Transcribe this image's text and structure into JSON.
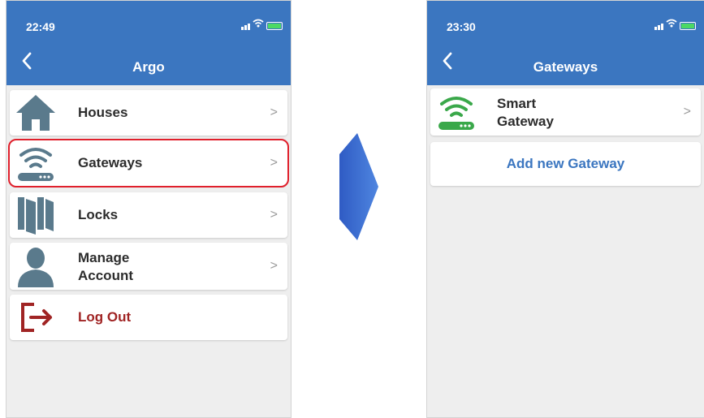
{
  "left_screen": {
    "status_time": "22:49",
    "title": "Argo",
    "menu": [
      {
        "label": "Houses",
        "icon": "house-icon"
      },
      {
        "label": "Gateways",
        "icon": "router-wifi-icon"
      },
      {
        "label": "Locks",
        "icon": "doors-icon"
      },
      {
        "label": "Manage Account",
        "icon": "person-icon"
      },
      {
        "label": "Log Out",
        "icon": "logout-icon"
      }
    ],
    "chevron": ">"
  },
  "right_screen": {
    "status_time": "23:30",
    "title": "Gateways",
    "gateway_item": {
      "label_line1": "Smart",
      "label_line2": "Gateway",
      "icon": "router-wifi-icon"
    },
    "add_button": "Add new Gateway",
    "chevron": ">"
  },
  "colors": {
    "header_blue": "#3b76c0",
    "highlight_red": "#e0202c",
    "logout_red": "#a02424",
    "icon_gray": "#5a7a8c",
    "gateway_green": "#3aa84a"
  }
}
